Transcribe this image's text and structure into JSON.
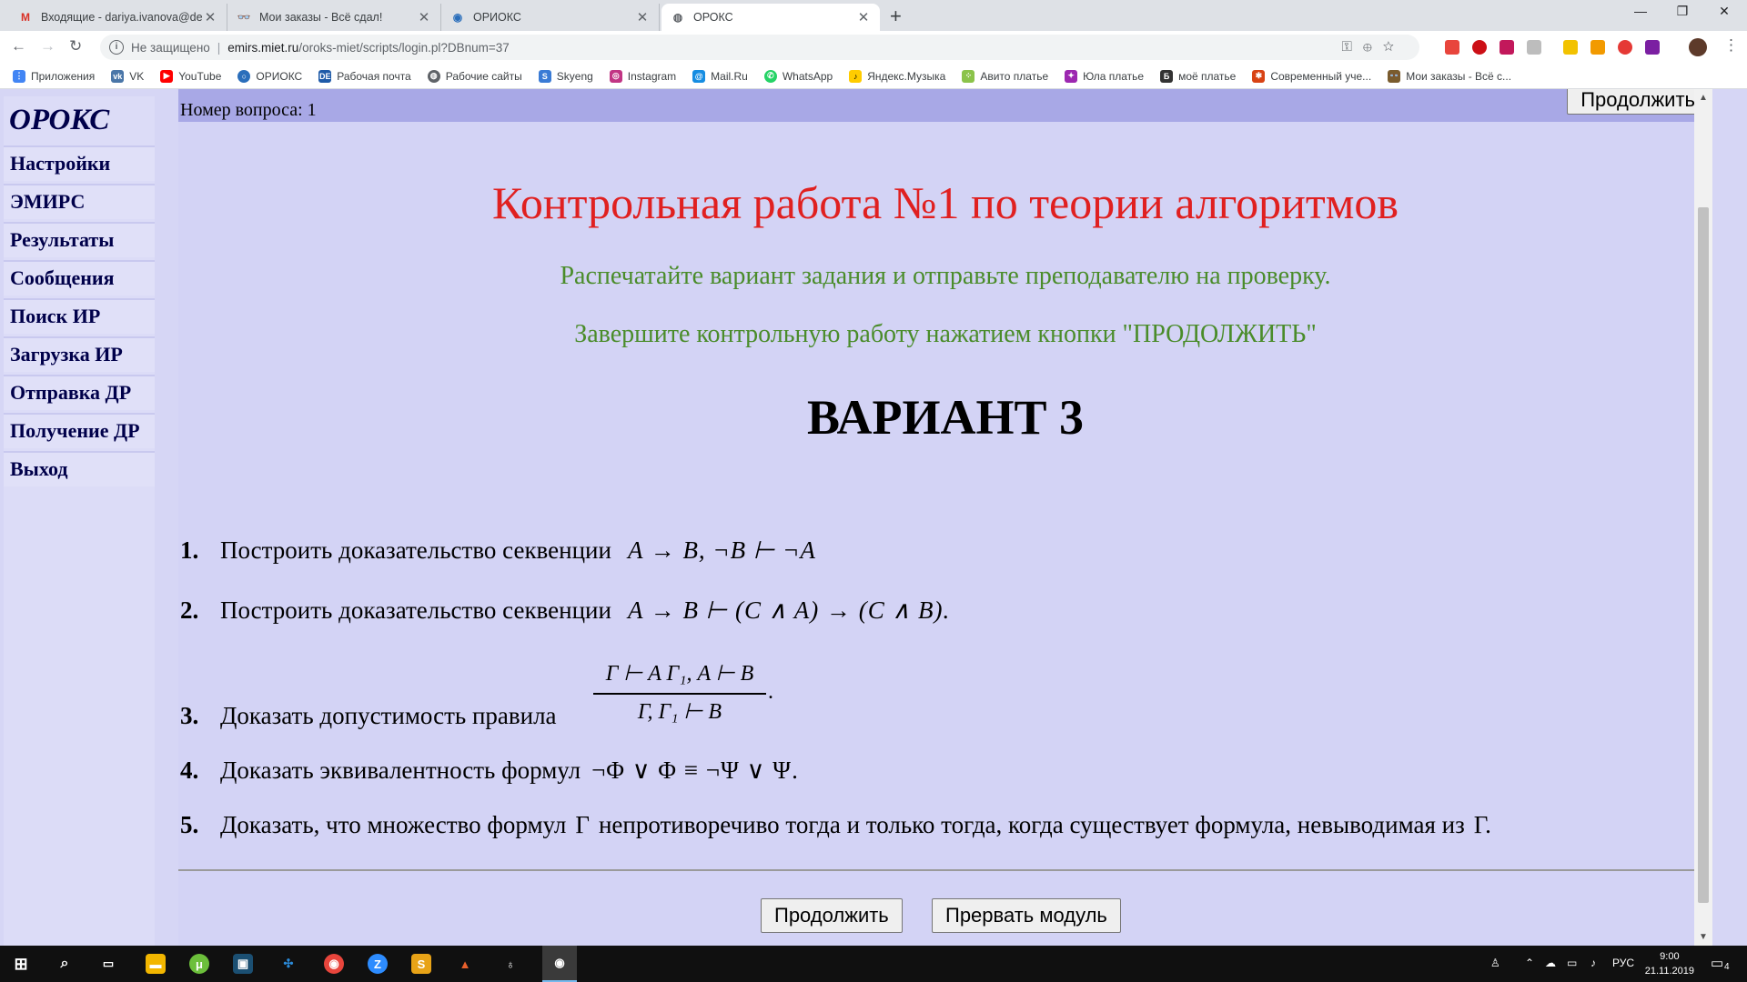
{
  "browser": {
    "tabs": [
      {
        "title": "Входящие - dariya.ivanova@dec",
        "favicon": "gmail-icon",
        "active": false
      },
      {
        "title": "Мои заказы - Всё сдал!",
        "favicon": "glasses-icon",
        "active": false
      },
      {
        "title": "ОРИОКС",
        "favicon": "orioks-icon",
        "active": false
      },
      {
        "title": "ОРОКС",
        "favicon": "globe-icon",
        "active": true
      }
    ],
    "address": {
      "security": "Не защищено",
      "host": "emirs.miet.ru",
      "path": "/oroks-miet/scripts/login.pl?DBnum=37"
    },
    "bookmarks": [
      "Приложения",
      "VK",
      "YouTube",
      "ОРИОКС",
      "Рабочая почта",
      "Рабочие сайты",
      "Skyeng",
      "Instagram",
      "Mail.Ru",
      "WhatsApp",
      "Яндекс.Музыка",
      "Авито платье",
      "Юла платье",
      "моё платье",
      "Современный уче...",
      "Мои заказы - Всё с..."
    ]
  },
  "sidebar": {
    "logo": "ОРОКС",
    "items": [
      "Настройки",
      "ЭМИРС",
      "Результаты",
      "Сообщения",
      "Поиск ИР",
      "Загрузка ИР",
      "Отправка ДР",
      "Получение ДР",
      "Выход"
    ]
  },
  "main": {
    "question_number": "Номер вопроса: 1",
    "top_button": "Продолжить",
    "title": "Контрольная работа №1 по теории алгоритмов",
    "instruction1": "Распечатайте вариант задания и отправьте преподавателю на проверку.",
    "instruction2": "Завершите контрольную работу нажатием кнопки \"ПРОДОЛЖИТЬ\"",
    "variant": "ВАРИАНТ 3",
    "tasks": [
      {
        "num": "1.",
        "text": "Построить доказательство секвенции",
        "formula": "A → B, ¬B ⊢ ¬A"
      },
      {
        "num": "2.",
        "text": "Построить доказательство секвенции",
        "formula": "A → B ⊢ (C ∧ A) → (C ∧ B)."
      },
      {
        "num": "3.",
        "text": "Доказать допустимость правила",
        "numerator": "Γ ⊢ A   Γ₁, A ⊢ B",
        "denominator": "Γ, Γ₁ ⊢ B",
        "tail": "."
      },
      {
        "num": "4.",
        "text": "Доказать эквивалентность формул",
        "formula": "¬Φ ∨ Φ ≡ ¬Ψ ∨ Ψ."
      },
      {
        "num": "5.",
        "text": "Доказать, что множество формул",
        "gamma": "Γ",
        "text2": "непротиворечиво тогда и только тогда, когда существует формула, невыводимая из",
        "tail": "Γ."
      }
    ],
    "buttons": {
      "continue": "Продолжить",
      "abort": "Прервать модуль"
    }
  },
  "taskbar": {
    "language": "РУС",
    "time": "9:00",
    "date": "21.11.2019",
    "notifications": "4"
  }
}
